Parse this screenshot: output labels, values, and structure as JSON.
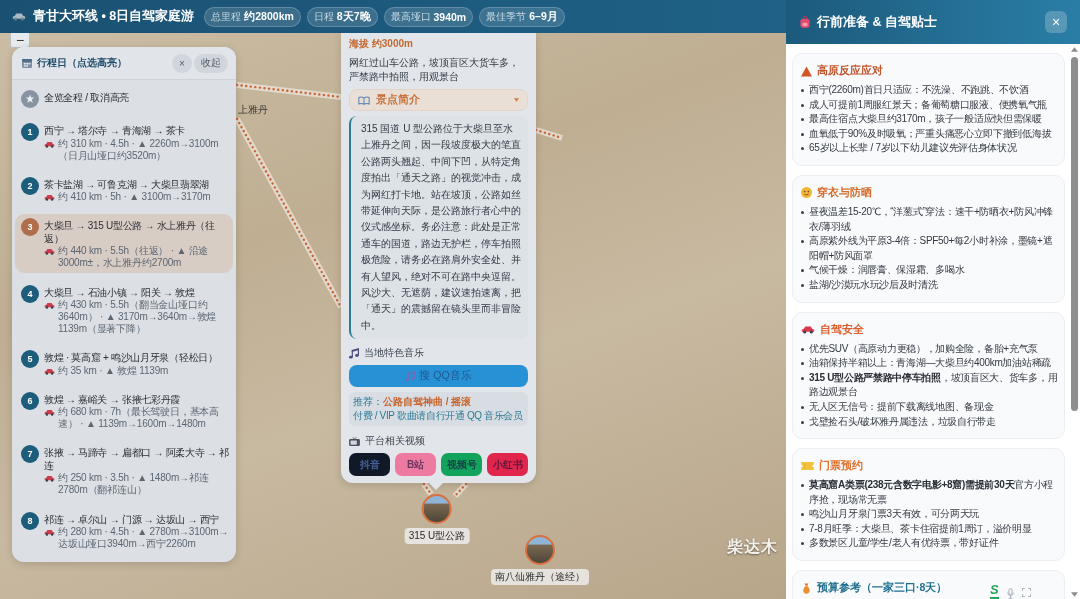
{
  "header": {
    "title": "青甘大环线 • 8日自驾家庭游",
    "stats": [
      {
        "label": "总里程",
        "value": "约2800km"
      },
      {
        "label": "日程",
        "value": "8天7晚"
      },
      {
        "label": "最高垭口",
        "value": "3940m"
      },
      {
        "label": "最佳季节",
        "value": "6–9月"
      }
    ]
  },
  "map": {
    "zoom_button": "−",
    "place_labels": [
      {
        "text": "上雅丹",
        "kind": "minor"
      },
      {
        "text": "柴达木",
        "kind": "region"
      }
    ],
    "markers": [
      {
        "label": "315 U型公路"
      },
      {
        "label": "南八仙雅丹（途经）"
      }
    ]
  },
  "itinerary": {
    "title": "行程日（点选高亮）",
    "close": "×",
    "collapse": "收起",
    "overview": {
      "label": "全览全程 / 取消高亮",
      "selected": false
    },
    "days": [
      {
        "number": "1",
        "title": "西宁 → 塔尔寺 → 青海湖 → 茶卡",
        "meta": "约 310 km · 4.5h · ▲ 2260m→3100m（日月山垭口约3520m）",
        "selected": false
      },
      {
        "number": "2",
        "title": "茶卡盐湖 → 可鲁克湖 → 大柴旦翡翠湖",
        "meta": "约 410 km · 5h · ▲ 3100m→3170m",
        "selected": false
      },
      {
        "number": "3",
        "title": "大柴旦 → 315 U型公路 → 水上雅丹（往返）",
        "meta": "约 440 km · 5.5h（往返） · ▲ 沿途3000m±，水上雅丹约2700m",
        "selected": true
      },
      {
        "number": "4",
        "title": "大柴旦 → 石油小镇 → 阳关 → 敦煌",
        "meta": "约 430 km · 5.5h（翻当金山垭口约3640m） · ▲ 3170m→3640m→敦煌1139m（显著下降）",
        "selected": false
      },
      {
        "number": "5",
        "title": "敦煌 · 莫高窟 + 鸣沙山月牙泉（轻松日）",
        "meta": "约 35 km · ▲ 敦煌 1139m",
        "selected": false
      },
      {
        "number": "6",
        "title": "敦煌 → 嘉峪关 → 张掖七彩丹霞",
        "meta": "约 680 km · 7h（最长驾驶日，基本高速） · ▲ 1139m→1600m→1480m",
        "selected": false
      },
      {
        "number": "7",
        "title": "张掖 → 马蹄寺 → 扁都口 → 阿柔大寺 → 祁连",
        "meta": "约 250 km · 3.5h · ▲ 1480m→祁连2780m（翻祁连山）",
        "selected": false
      },
      {
        "number": "8",
        "title": "祁连 → 卓尔山 → 门源 → 达坂山 → 西宁",
        "meta": "约 280 km · 4.5h · ▲ 2780m→3100m→达坂山垭口3940m→西宁2260m",
        "selected": false
      }
    ]
  },
  "popup": {
    "altitude": "海拔 约3000m",
    "warning": "网红过山车公路，坡顶盲区大货车多，严禁路中拍照，用观景台",
    "intro": {
      "label": "景点简介",
      "expanded": true
    },
    "description": "315 国道 U 型公路位于大柴旦至水上雅丹之间，因一段坡度极大的笔直公路两头翘起、中间下凹，从特定角度拍出「通天之路」的视觉冲击，成为网红打卡地。站在坡顶，公路如丝带延伸向天际，是公路旅行者心中的仪式感坐标。务必注意：此处是正常通车的国道，路边无护栏，停车拍照极危险，请务必在路肩外安全处、并有人望风，绝对不可在路中央逗留。风沙大、无遮荫，建议速拍速离，把「通天」的震撼留在镜头里而非冒险中。",
    "music": {
      "heading": "当地特色音乐",
      "button": "搜 QQ音乐",
      "recommendation": "推荐：**公路自驾神曲 / 摇滚**",
      "note": "付费 / VIP 歌曲请自行开通 QQ 音乐会员"
    },
    "videos": {
      "heading": "平台相关视频",
      "buttons": [
        {
          "label": "抖音",
          "color": "#111827"
        },
        {
          "label": "B站",
          "color": "#ee7aa2"
        },
        {
          "label": "视频号",
          "color": "#12a45c"
        },
        {
          "label": "小红书",
          "color": "#e0264c"
        }
      ]
    }
  },
  "tips": {
    "title": "行前准备 & 自驾贴士",
    "close": "×",
    "sections": [
      {
        "kind": "altitude",
        "title": "高原反应应对",
        "items": [
          "西宁(2260m)首日只适应：不洗澡、不跑跳、不饮酒",
          "成人可提前1周服红景天；备葡萄糖口服液、便携氧气瓶",
          "最高住宿点大柴旦约3170m，孩子一般适应快但需保暖",
          "血氧低于90%及时吸氧；严重头痛恶心立即下撤到低海拔",
          "65岁以上长辈 / 7岁以下幼儿建议先评估身体状况"
        ]
      },
      {
        "kind": "clothing",
        "title": "穿衣与防晒",
        "items": [
          "昼夜温差15-20℃，“洋葱式”穿法：速干+防晒衣+防风冲锋衣/薄羽绒",
          "高原紫外线为平原3-4倍：SPF50+每2小时补涂，墨镜+遮阳帽+防风面罩",
          "气候干燥：润唇膏、保湿霜、多喝水",
          "盐湖/沙漠玩水玩沙后及时清洗"
        ]
      },
      {
        "kind": "driving",
        "title": "自驾安全",
        "items": [
          "优先SUV（高原动力更稳），加购全险，备胎+充气泵",
          "油箱保持半箱以上：青海湖—大柴旦约400km加油站稀疏",
          "**315 U型公路严禁路中停车拍照**，坡顶盲区大、货车多，用路边观景台",
          "无人区无信号：提前下载离线地图、备现金",
          "戈壁捡石头/破坏雅丹属违法，垃圾自行带走"
        ]
      },
      {
        "kind": "tickets",
        "title": "门票预约",
        "items": [
          "**莫高窟A类票(238元含数字电影+8窟)需提前30天**官方小程序抢，现场常无票",
          "鸣沙山月牙泉门票3天有效，可分两天玩",
          "7-8月旺季：大柴旦、茶卡住宿提前1周订，溢价明显",
          "多数景区儿童/学生/老人有优待票，带好证件"
        ]
      },
      {
        "kind": "budget",
        "title": "预算参考（一家三口·8天）"
      }
    ]
  },
  "input_toolbar": {
    "logo": "S"
  }
}
